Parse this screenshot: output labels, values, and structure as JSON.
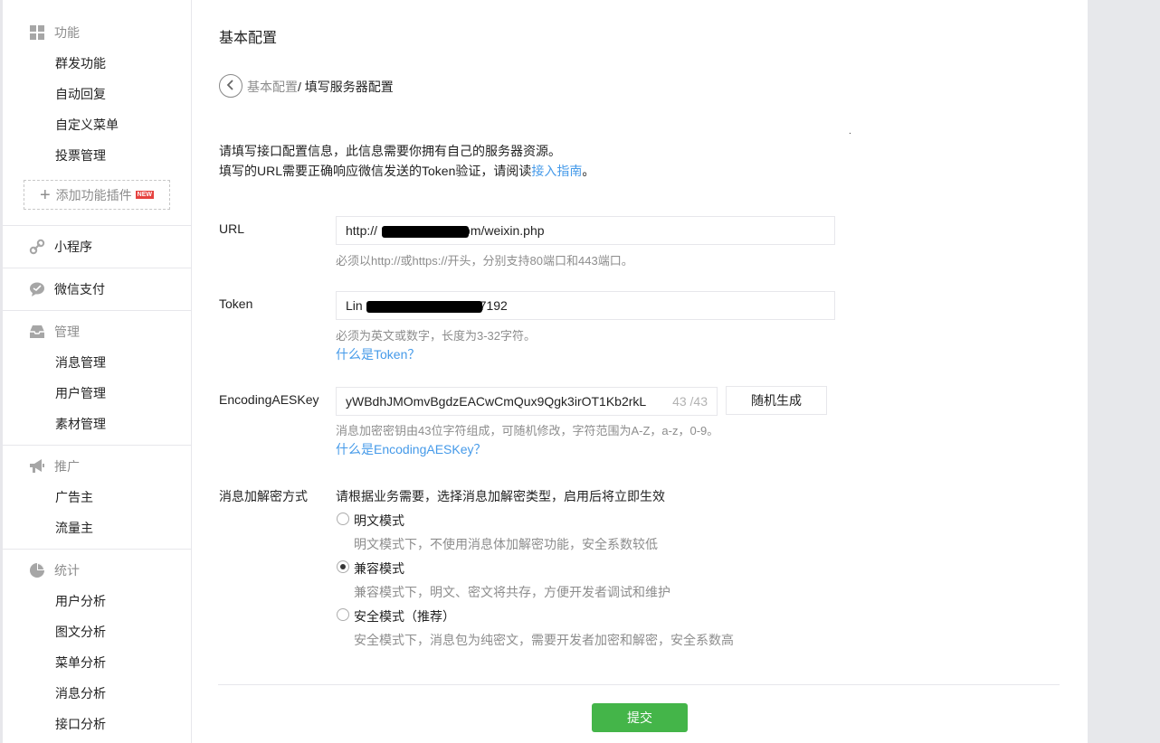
{
  "sidebar": {
    "func": {
      "label": "功能",
      "icon": "grid-icon",
      "items": [
        "群发功能",
        "自动回复",
        "自定义菜单",
        "投票管理"
      ]
    },
    "add_plugin": {
      "label": "添加功能插件",
      "badge": "NEW"
    },
    "mini_program": {
      "label": "小程序",
      "icon": "link-icon"
    },
    "pay": {
      "label": "微信支付",
      "icon": "chat-pay-icon"
    },
    "manage": {
      "label": "管理",
      "icon": "inbox-icon",
      "items": [
        "消息管理",
        "用户管理",
        "素材管理"
      ]
    },
    "promo": {
      "label": "推广",
      "icon": "megaphone-icon",
      "items": [
        "广告主",
        "流量主"
      ]
    },
    "stats": {
      "label": "统计",
      "icon": "pie-chart-icon",
      "items": [
        "用户分析",
        "图文分析",
        "菜单分析",
        "消息分析",
        "接口分析"
      ]
    }
  },
  "main": {
    "title": "基本配置",
    "breadcrumb": {
      "parent": "基本配置",
      "current": "/ 填写服务器配置"
    },
    "stray_dot": ".",
    "intro_line1": "请填写接口配置信息，此信息需要你拥有自己的服务器资源。",
    "intro_line2_pre": "填写的URL需要正确响应微信发送的Token验证，请阅读",
    "intro_link": "接入指南",
    "intro_line2_post": "。",
    "url": {
      "label": "URL",
      "value_prefix": "http://",
      "value_suffix": "com/weixin.php",
      "hint": "必须以http://或https://开头，分别支持80端口和443端口。"
    },
    "token": {
      "label": "Token",
      "value_prefix": "Lin",
      "value_suffix": "7192",
      "hint": "必须为英文或数字，长度为3-32字符。",
      "help_link": "什么是Token？"
    },
    "aes": {
      "label": "EncodingAESKey",
      "value": "yWBdhJMOmvBgdzEACwCmQux9Qgk3irOT1Kb2rkL",
      "count": "43 /43",
      "generate_button": "随机生成",
      "hint": "消息加密密钥由43位字符组成，可随机修改，字符范围为A-Z，a-z，0-9。",
      "help_link": "什么是EncodingAESKey？"
    },
    "encryption": {
      "label": "消息加解密方式",
      "prompt": "请根据业务需要，选择消息加解密类型，启用后将立即生效",
      "options": [
        {
          "label": "明文模式",
          "desc": "明文模式下，不使用消息体加解密功能，安全系数较低",
          "checked": false
        },
        {
          "label": "兼容模式",
          "desc": "兼容模式下，明文、密文将共存，方便开发者调试和维护",
          "checked": true
        },
        {
          "label": "安全模式（推荐）",
          "desc": "安全模式下，消息包为纯密文，需要开发者加密和解密，安全系数高",
          "checked": false
        }
      ]
    },
    "submit": "提交"
  }
}
